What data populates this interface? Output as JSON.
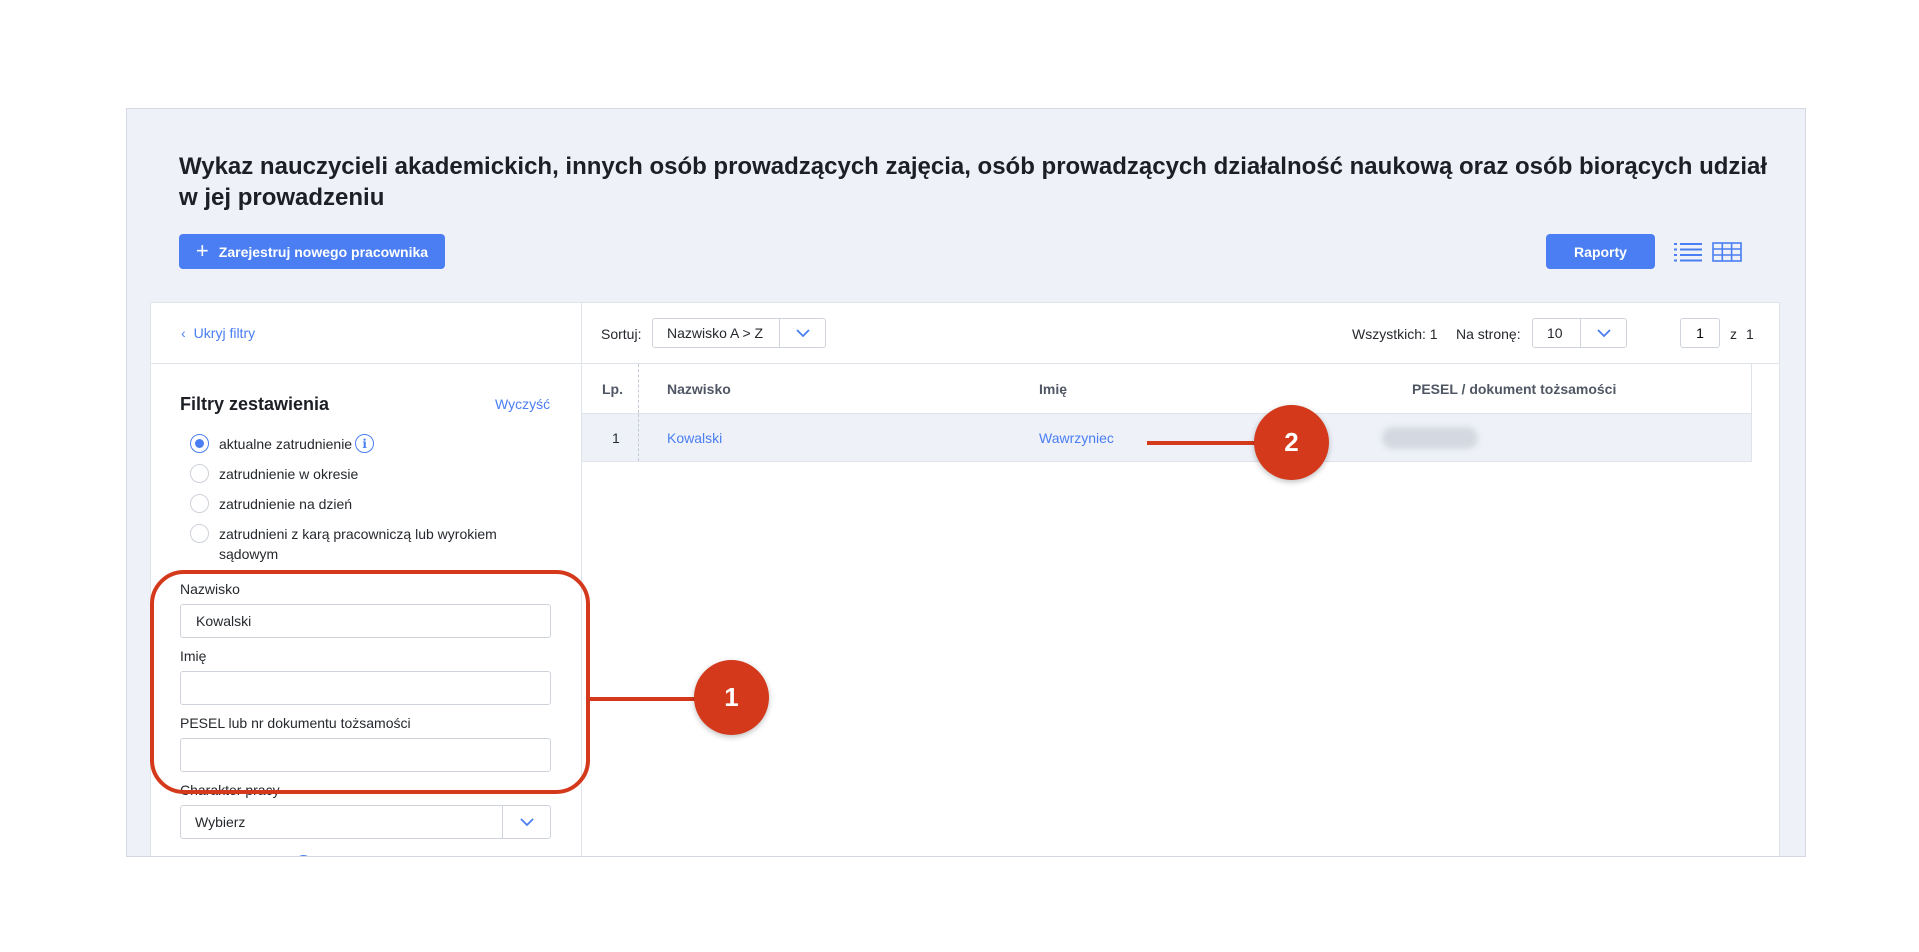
{
  "page": {
    "title": "Wykaz nauczycieli akademickich, innych osób prowadzących zajęcia, osób prowadzących działalność naukową oraz osób biorących udział w jej prowadzeniu"
  },
  "actions": {
    "register_label": "Zarejestruj nowego pracownika",
    "reports_label": "Raporty",
    "primary_color": "#4a7ef2"
  },
  "filters": {
    "hide_label": "Ukryj filtry",
    "title": "Filtry zestawienia",
    "clear_label": "Wyczyść",
    "employment_options": [
      {
        "label": "aktualne zatrudnienie",
        "selected": true
      },
      {
        "label": "zatrudnienie w okresie",
        "selected": false
      },
      {
        "label": "zatrudnienie na dzień",
        "selected": false
      },
      {
        "label": "zatrudnieni z karą pracowniczą lub wyrokiem sądowym",
        "selected": false
      }
    ],
    "surname": {
      "label": "Nazwisko",
      "value": "Kowalski"
    },
    "first_name": {
      "label": "Imię",
      "value": ""
    },
    "pesel": {
      "label": "PESEL lub nr dokumentu tożsamości",
      "value": ""
    },
    "work_type": {
      "label": "Charakter pracy",
      "value": "Wybierz"
    }
  },
  "toolbar": {
    "sort_label": "Sortuj:",
    "sort_value": "Nazwisko A > Z",
    "total_label": "Wszystkich: 1",
    "per_page_label": "Na stronę:",
    "per_page_value": "10",
    "page_value": "1",
    "page_of": "z",
    "page_total": "1"
  },
  "table": {
    "columns": [
      "Lp.",
      "Nazwisko",
      "Imię",
      "PESEL / dokument tożsamości"
    ],
    "rows": [
      {
        "lp": "1",
        "surname": "Kowalski",
        "first_name": "Wawrzyniec",
        "pesel": ""
      }
    ]
  },
  "annotations": {
    "badge_1": "1",
    "badge_2": "2",
    "color": "#d3391a"
  }
}
